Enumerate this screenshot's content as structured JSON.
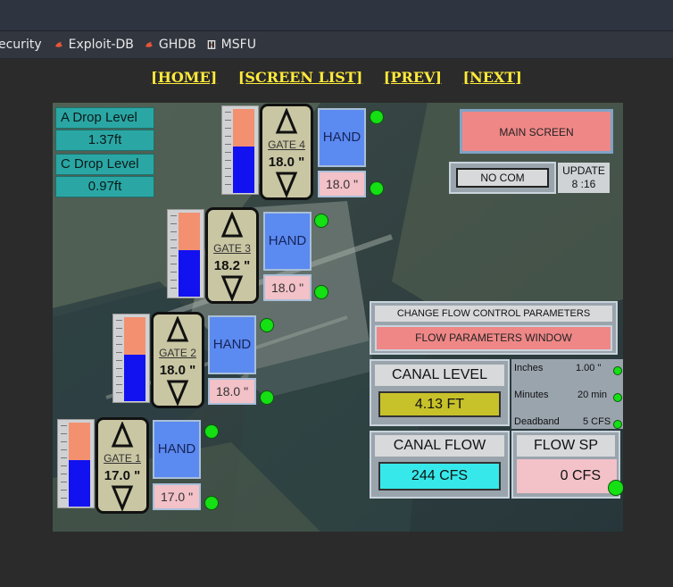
{
  "bookmarks": {
    "items": [
      {
        "label": "ecurity",
        "icon": "none"
      },
      {
        "label": "Exploit-DB",
        "icon": "flame-icon"
      },
      {
        "label": "GHDB",
        "icon": "flame-icon"
      },
      {
        "label": "MSFU",
        "icon": "msfu-icon"
      }
    ]
  },
  "nav": {
    "home": "[HOME]",
    "screen_list": "[SCREEN LIST]",
    "prev": "[PREV]",
    "next": "[NEXT]"
  },
  "levels": {
    "a_drop_label": "A Drop Level",
    "a_drop_value": "1.37ft",
    "c_drop_label": "C Drop Level",
    "c_drop_value": "0.97ft"
  },
  "gates": [
    {
      "name": "GATE 1",
      "value": "17.0 \"",
      "hand": "HAND",
      "setpoint": "17.0 \"",
      "level_top_fraction": 0.45
    },
    {
      "name": "GATE 2",
      "value": "18.0 \"",
      "hand": "HAND",
      "setpoint": "18.0 \"",
      "level_top_fraction": 0.45
    },
    {
      "name": "GATE 3",
      "value": "18.2 \"",
      "hand": "HAND",
      "setpoint": "18.0 \"",
      "level_top_fraction": 0.45
    },
    {
      "name": "GATE 4",
      "value": "18.0 \"",
      "hand": "HAND",
      "setpoint": "18.0 \"",
      "level_top_fraction": 0.45
    }
  ],
  "main_screen": "MAIN SCREEN",
  "comm": {
    "status": "NO COM",
    "update_label": "UPDATE",
    "update_time": "8 :16"
  },
  "flow_params": {
    "header": "CHANGE FLOW CONTROL PARAMETERS",
    "button": "FLOW PARAMETERS WINDOW"
  },
  "canal_level": {
    "label": "CANAL LEVEL",
    "value": "4.13 FT"
  },
  "canal_flow": {
    "label": "CANAL FLOW",
    "value": "244 CFS"
  },
  "flow_sp": {
    "label": "FLOW SP",
    "value": "0 CFS"
  },
  "params": [
    {
      "name": "Inches",
      "value": "1.00 \""
    },
    {
      "name": "Minutes",
      "value": "20 min"
    },
    {
      "name": "Deadband",
      "value": "5 CFS"
    }
  ],
  "colors": {
    "teal": "#2aa7a4",
    "hand_blue": "#5b8af0",
    "pink": "#f3c1c8",
    "alarm_green": "#14e014",
    "level_yellow": "#c8c22a",
    "flow_cyan": "#36e8ea",
    "tank_orange": "#f39070",
    "tank_blue": "#1212f0"
  }
}
